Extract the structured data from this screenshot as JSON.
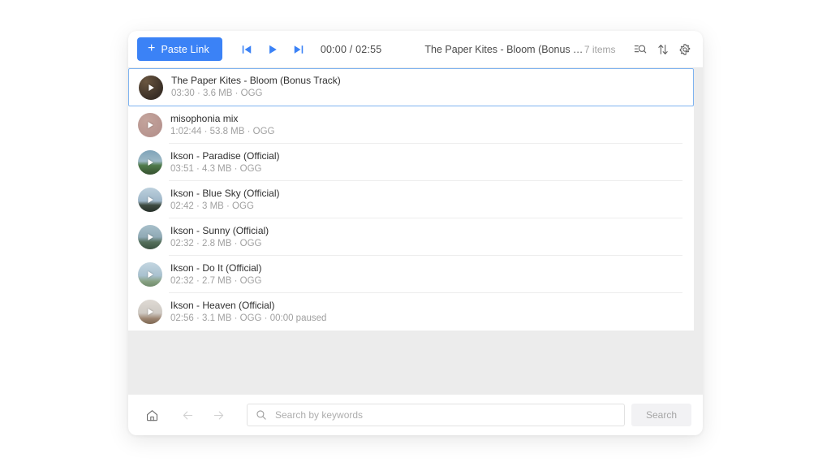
{
  "toolbar": {
    "paste_button_label": "Paste Link",
    "paste_button_icon": "plus-icon",
    "prev_icon": "skip-previous-icon",
    "play_icon": "play-icon",
    "next_icon": "skip-next-icon",
    "time_display": "00:00 / 02:55",
    "now_playing": "The Paper Kites - Bloom (Bonus Track)",
    "item_count": "7 items",
    "filter_icon": "list-search-icon",
    "sort_icon": "sort-arrows-icon",
    "settings_icon": "gear-icon",
    "accent_color": "#3b82f6"
  },
  "tracks": [
    {
      "title": "The Paper Kites - Bloom (Bonus Track)",
      "subtitle": "03:30 · 3.6 MB · OGG",
      "thumb_color": "#3a2f26",
      "thumb_color2": "#6a5640",
      "selected": true
    },
    {
      "title": "misophonia mix",
      "subtitle": "1:02:44 · 53.8 MB · OGG",
      "thumb_color": "#b6938e",
      "thumb_color2": "#c4a49c",
      "selected": false
    },
    {
      "title": "Ikson - Paradise (Official)",
      "subtitle": "03:51 · 4.3 MB · OGG",
      "thumb_color": "#6d8ea2",
      "thumb_color2": "#4f7a4a",
      "selected": false
    },
    {
      "title": "Ikson - Blue Sky (Official)",
      "subtitle": "02:42 · 3 MB · OGG",
      "thumb_color": "#9fb7c9",
      "thumb_color2": "#2f3a33",
      "selected": false
    },
    {
      "title": "Ikson - Sunny (Official)",
      "subtitle": "02:32 · 2.8 MB · OGG",
      "thumb_color": "#8fa9b5",
      "thumb_color2": "#4d6b58",
      "selected": false
    },
    {
      "title": "Ikson - Do It (Official)",
      "subtitle": "02:32 · 2.7 MB · OGG",
      "thumb_color": "#a9c1cf",
      "thumb_color2": "#7f9a7c",
      "selected": false
    },
    {
      "title": "Ikson - Heaven (Official)",
      "subtitle": "02:56 · 3.1 MB · OGG · 00:00 paused",
      "thumb_color": "#cfcac4",
      "thumb_color2": "#8a7360",
      "selected": false
    }
  ],
  "bottom_bar": {
    "home_icon": "home-icon",
    "back_icon": "arrow-left-icon",
    "forward_icon": "arrow-right-icon",
    "search_icon": "search-icon",
    "search_value": "",
    "search_placeholder": "Search by keywords",
    "search_button_label": "Search"
  }
}
